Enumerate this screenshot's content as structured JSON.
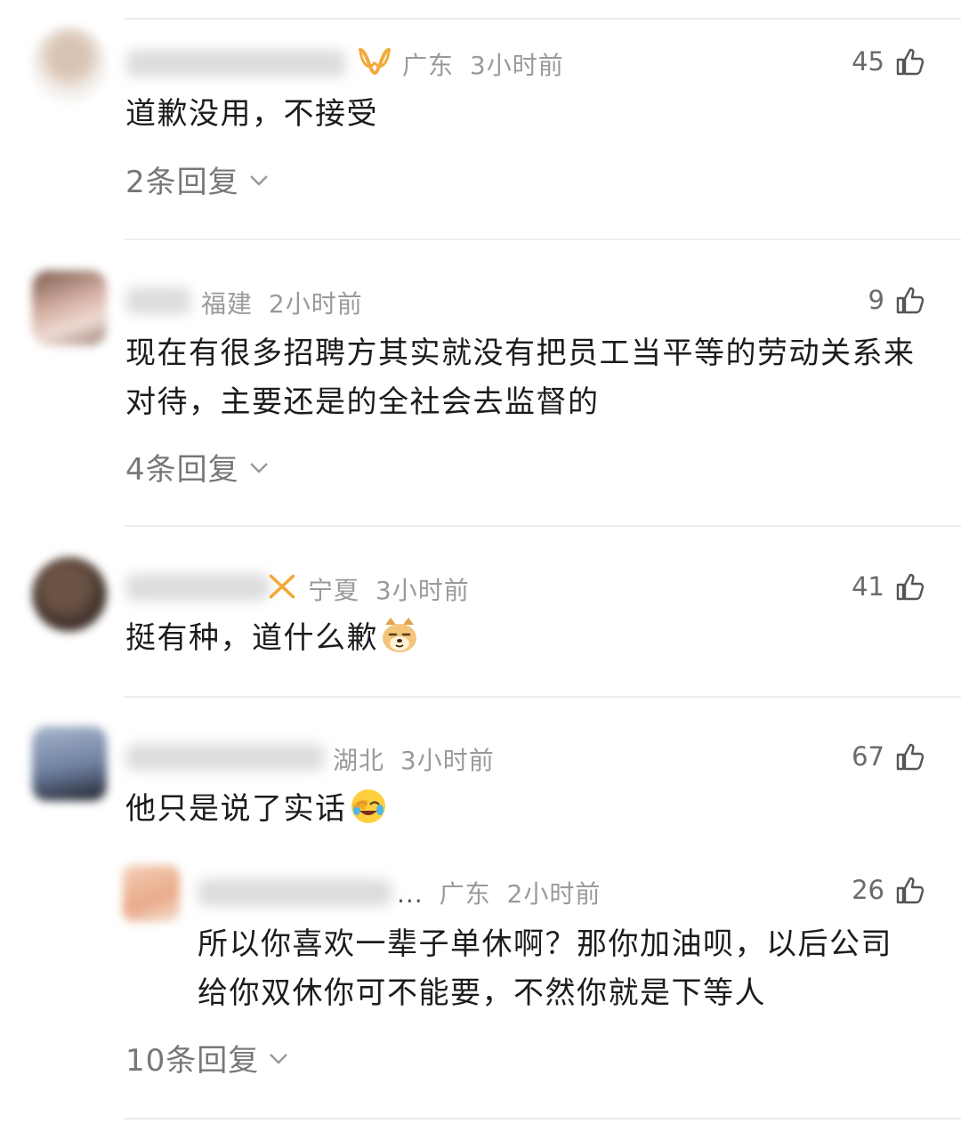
{
  "comments": [
    {
      "location": "广东",
      "time": "3小时前",
      "likes": "45",
      "text": "道歉没用，不接受",
      "replies": "2条回复",
      "colors": [
        "#e8d7c9",
        "#c9b19d"
      ]
    },
    {
      "location": "福建",
      "time": "2小时前",
      "likes": "9",
      "text": "现在有很多招聘方其实就没有把员工当平等的劳动关系来对待，主要还是的全社会去监督的",
      "replies": "4条回复",
      "colors": [
        "#b08b7d",
        "#e2c7bf"
      ]
    },
    {
      "location": "宁夏",
      "time": "3小时前",
      "likes": "41",
      "text": "挺有种，道什么歉",
      "emoji": "doge-emoji",
      "colors": [
        "#5b4539",
        "#9f7e6d"
      ]
    },
    {
      "location": "湖北",
      "time": "3小时前",
      "likes": "67",
      "text": "他只是说了实话",
      "emoji": "facepalm-laugh-emoji",
      "replies": "10条回复",
      "colors": [
        "#8e9db6",
        "#3a3f4d"
      ]
    }
  ],
  "reply": {
    "ellipsis": "...",
    "location": "广东",
    "time": "2小时前",
    "likes": "26",
    "text": "所以你喜欢一辈子单休啊？那你加油呗，以后公司给你双休你可不能要，不然你就是下等人",
    "colors": [
      "#f0c6a4",
      "#e7a98b"
    ]
  },
  "accent": "#f2a93b"
}
